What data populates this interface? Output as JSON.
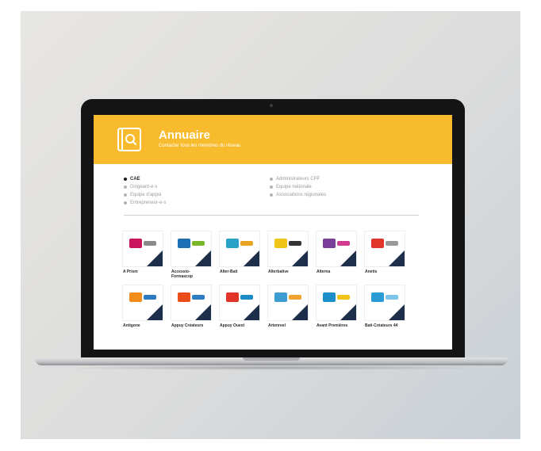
{
  "header": {
    "title": "Annuaire",
    "subtitle": "Contacter tous les membres du réseau",
    "accent_color": "#f7bb2d",
    "icon": "book-search-icon"
  },
  "filters": {
    "column1": [
      {
        "label": "CAE",
        "active": true
      },
      {
        "label": "Dirigeant-e-s",
        "active": false
      },
      {
        "label": "Equipe d'appui",
        "active": false
      },
      {
        "label": "Entrepreneur-e-s",
        "active": false
      }
    ],
    "column2": [
      {
        "label": "Administrateurs CPF",
        "active": false
      },
      {
        "label": "Equipe nationale",
        "active": false
      },
      {
        "label": "Associations régionales",
        "active": false
      }
    ]
  },
  "members": [
    {
      "name": "A Prism",
      "colors": [
        "#c8155c",
        "#8a8a8a"
      ]
    },
    {
      "name": "Accessio-Formascop",
      "colors": [
        "#1b6fb2",
        "#79b628"
      ]
    },
    {
      "name": "Alter-Bati",
      "colors": [
        "#2aa1c9",
        "#e8a321"
      ]
    },
    {
      "name": "Alterbative",
      "colors": [
        "#f0c419",
        "#333333"
      ]
    },
    {
      "name": "Alterna",
      "colors": [
        "#7a3f98",
        "#d23b8f"
      ]
    },
    {
      "name": "Anetis",
      "colors": [
        "#e2352a",
        "#9a9a9a"
      ]
    },
    {
      "name": "Antigone",
      "colors": [
        "#f28c1b",
        "#2c7bbf"
      ]
    },
    {
      "name": "Appuy Créateurs",
      "colors": [
        "#e94e1b",
        "#2e7ec1"
      ]
    },
    {
      "name": "Appuy Ouest",
      "colors": [
        "#e2352a",
        "#1d8bc7"
      ]
    },
    {
      "name": "Artenreel",
      "colors": [
        "#3d9cd2",
        "#f0a22e"
      ]
    },
    {
      "name": "Avant Premières",
      "colors": [
        "#1b8fc9",
        "#f0c419"
      ]
    },
    {
      "name": "Bati-Créateurs 44",
      "colors": [
        "#2b9bd6",
        "#7cc3e8"
      ]
    }
  ],
  "corner_color": "#1d2f4a"
}
